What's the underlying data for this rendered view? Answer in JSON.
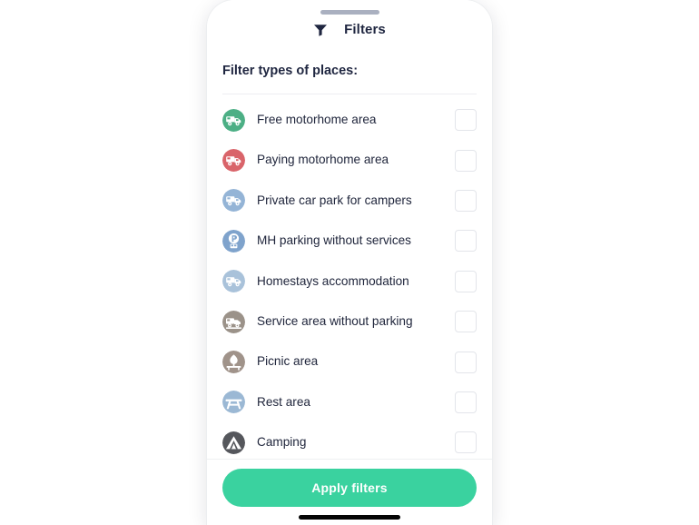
{
  "sheet": {
    "drag_handle": "drag-handle",
    "filter_icon": "funnel-icon",
    "title": "Filters",
    "section_title": "Filter types of places:"
  },
  "colors": {
    "accent_green": "#3ad29f",
    "title_navy": "#1f2640",
    "label_text": "#20263c",
    "checkbox_border": "#e3e5ea",
    "divider": "#ededf1",
    "handle": "#aab0c0"
  },
  "filters": [
    {
      "label": "Free motorhome area",
      "icon": "motorhome-icon",
      "icon_color": "#4caf85",
      "checked": false
    },
    {
      "label": "Paying motorhome area",
      "icon": "motorhome-icon",
      "icon_color": "#d9646a",
      "checked": false
    },
    {
      "label": "Private car park for campers",
      "icon": "motorhome-icon",
      "icon_color": "#94b4d6",
      "checked": false
    },
    {
      "label": "MH parking without services",
      "icon": "parking-p-icon",
      "icon_color": "#7fa3cc",
      "checked": false
    },
    {
      "label": "Homestays accommodation",
      "icon": "motorhome-icon",
      "icon_color": "#a9c2da",
      "checked": false
    },
    {
      "label": "Service area without parking",
      "icon": "service-station-icon",
      "icon_color": "#9b9289",
      "checked": false
    },
    {
      "label": "Picnic area",
      "icon": "picnic-tree-icon",
      "icon_color": "#a0938a",
      "checked": false
    },
    {
      "label": "Rest area",
      "icon": "picnic-table-icon",
      "icon_color": "#9bb8d4",
      "checked": false
    },
    {
      "label": "Camping",
      "icon": "tent-icon",
      "icon_color": "#55575c",
      "checked": false
    }
  ],
  "footer": {
    "apply_label": "Apply filters",
    "home_indicator": "home-indicator"
  }
}
